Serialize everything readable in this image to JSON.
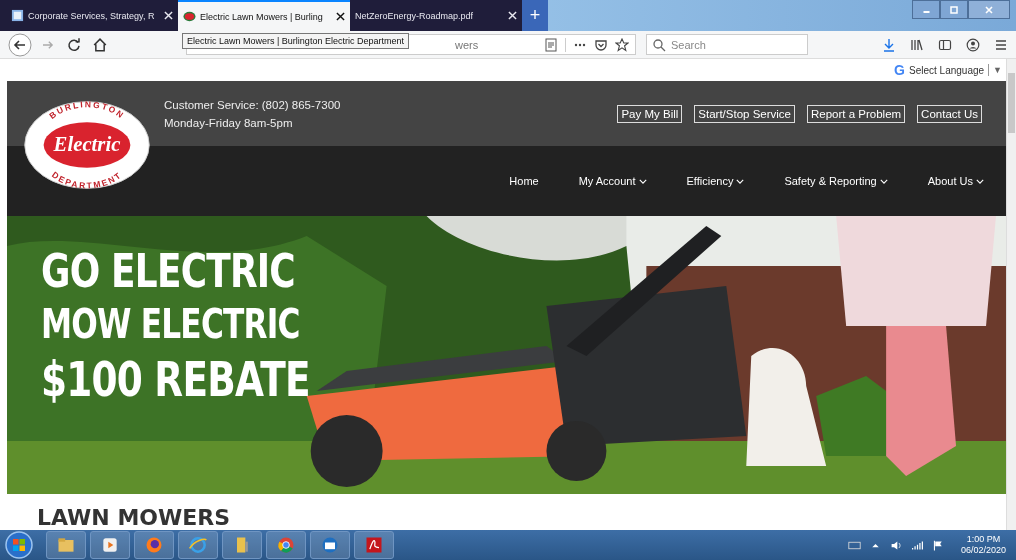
{
  "browser": {
    "tabs": [
      {
        "title": "Corporate Services, Strategy, R",
        "selected": false
      },
      {
        "title": "Electric Lawn Mowers | Burling",
        "selected": true
      },
      {
        "title": "NetZeroEnergy-Roadmap.pdf",
        "selected": false
      }
    ],
    "new_tab": "+",
    "address": "wers",
    "tooltip": "Electric Lawn Mowers | Burlington Electric Department",
    "search": {
      "placeholder": "Search"
    }
  },
  "translate": {
    "logo": "G",
    "label": "Select Language",
    "arrow": "▼"
  },
  "header": {
    "logo": {
      "top": "BURLINGTON",
      "main": "Electric",
      "bottom": "DEPARTMENT"
    },
    "contact": [
      "Customer Service: (802) 865-7300",
      "Monday-Friday 8am-5pm"
    ],
    "buttons": [
      "Pay My Bill",
      "Start/Stop Service",
      "Report a Problem",
      "Contact Us"
    ],
    "nav": [
      {
        "label": "Home",
        "dropdown": false
      },
      {
        "label": "My Account",
        "dropdown": true
      },
      {
        "label": "Efficiency",
        "dropdown": true
      },
      {
        "label": "Safety & Reporting",
        "dropdown": true
      },
      {
        "label": "About Us",
        "dropdown": true
      }
    ]
  },
  "hero": {
    "lines": [
      "GO ELECTRIC",
      "MOW ELECTRIC",
      "$100 REBATE"
    ]
  },
  "heading": "LAWN MOWERS",
  "taskbar": {
    "time": "1:00 PM",
    "date": "06/02/2020"
  }
}
